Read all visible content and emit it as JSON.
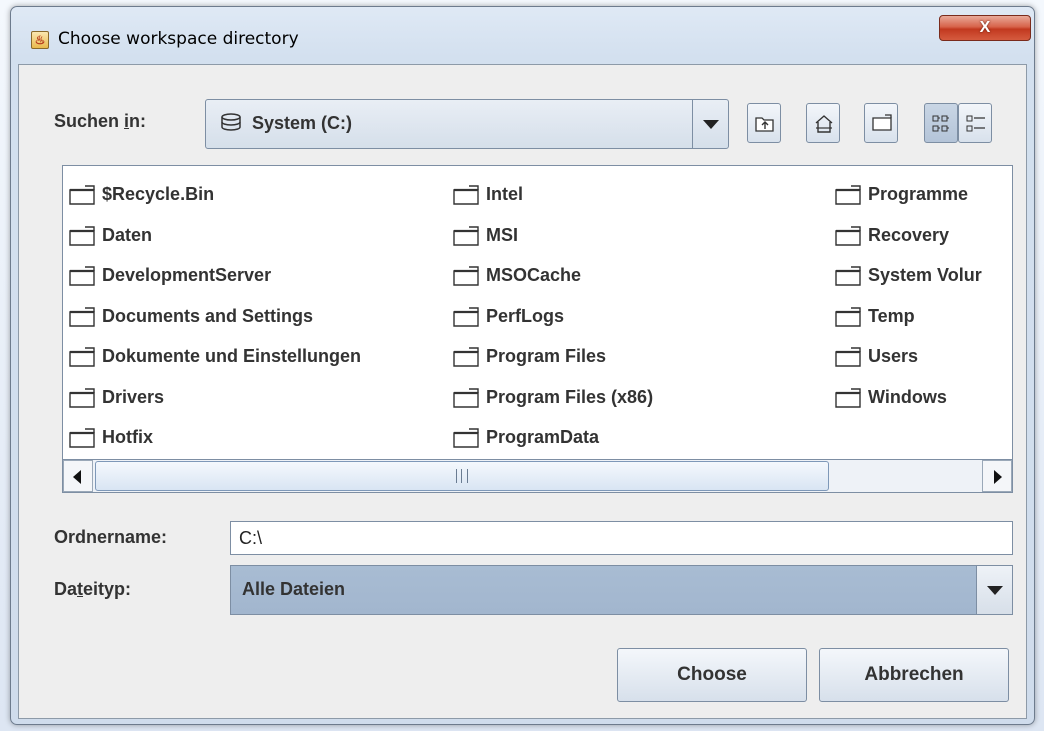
{
  "window": {
    "title": "Choose workspace directory",
    "close_label": "X"
  },
  "look_in": {
    "label_pre": "Suchen ",
    "label_mnemonic": "i",
    "label_post": "n:",
    "value": "System (C:)",
    "icon": "drive-icon"
  },
  "toolbar": {
    "buttons": [
      "up-one-level-icon",
      "home-icon",
      "new-folder-icon",
      "list-view-icon",
      "details-view-icon"
    ]
  },
  "files": {
    "col1": [
      "$Recycle.Bin",
      "Daten",
      "DevelopmentServer",
      "Documents and Settings",
      "Dokumente und Einstellungen",
      "Drivers",
      "Hotfix"
    ],
    "col2": [
      "Intel",
      "MSI",
      "MSOCache",
      "PerfLogs",
      "Program Files",
      "Program Files (x86)",
      "ProgramData"
    ],
    "col3": [
      "Programme",
      "Recovery",
      "System Volur",
      "Temp",
      "Users",
      "Windows"
    ]
  },
  "folder_name": {
    "label": "Ordnername:",
    "value": "C:\\"
  },
  "file_type": {
    "label_pre": "Da",
    "label_mnemonic": "t",
    "label_post": "eityp:",
    "value": "Alle Dateien"
  },
  "buttons": {
    "choose": "Choose",
    "cancel": "Abbrechen"
  },
  "colors": {
    "selected_combo": "#a5b9d1",
    "close_button": "#c94a30"
  }
}
